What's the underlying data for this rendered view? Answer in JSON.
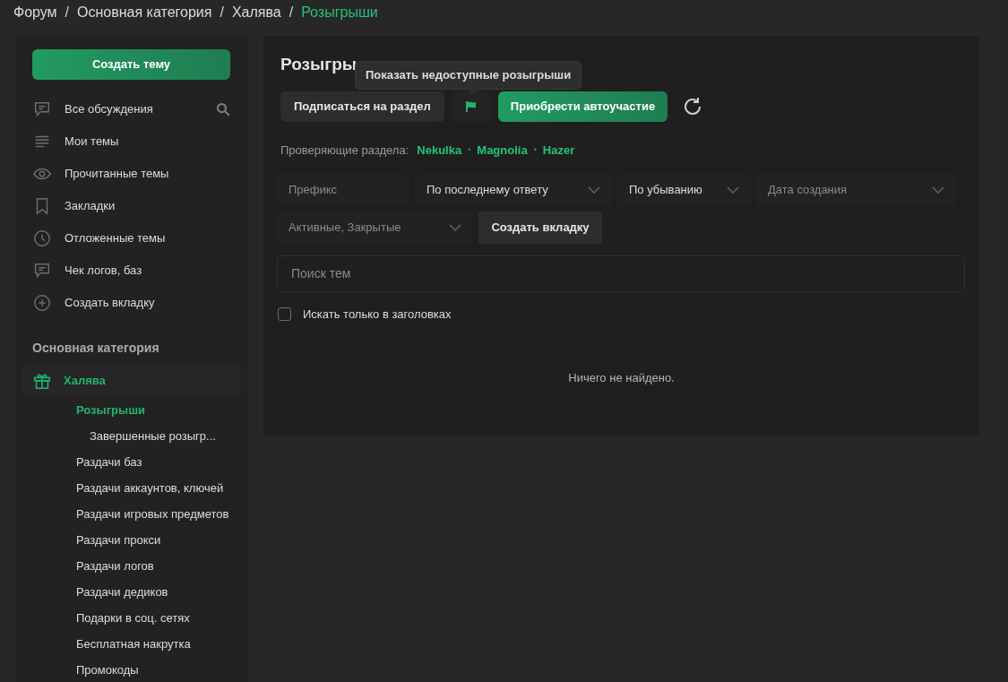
{
  "breadcrumbs": [
    {
      "label": "Форум",
      "selected": false
    },
    {
      "label": "Основная категория",
      "selected": false
    },
    {
      "label": "Халява",
      "selected": false
    },
    {
      "label": "Розыгрыши",
      "selected": true
    }
  ],
  "breadcrumb_separator": "/",
  "sidebar": {
    "create_button": "Создать тему",
    "nav_items": [
      {
        "label": "Все обсуждения",
        "search": true
      },
      {
        "label": "Мои темы",
        "search": false
      },
      {
        "label": "Прочитанные темы",
        "search": false
      },
      {
        "label": "Закладки",
        "search": false
      },
      {
        "label": "Отложенные темы",
        "search": false
      },
      {
        "label": "Чек логов, баз",
        "search": false
      },
      {
        "label": "Создать вкладку",
        "search": false
      }
    ],
    "section_title": "Основная категория",
    "categories": [
      {
        "label": "Халява",
        "selected": true,
        "children": [
          {
            "label": "Розыгрыши",
            "selected": true,
            "children": [
              {
                "label": "Завершенные розыгр...",
                "selected": false
              }
            ]
          },
          {
            "label": "Раздачи баз",
            "selected": false
          },
          {
            "label": "Раздачи аккаунтов, ключей",
            "selected": false
          },
          {
            "label": "Раздачи игровых предметов",
            "selected": false
          },
          {
            "label": "Раздачи прокси",
            "selected": false
          },
          {
            "label": "Раздачи логов",
            "selected": false
          },
          {
            "label": "Раздачи дедиков",
            "selected": false
          },
          {
            "label": "Подарки в соц. сетях",
            "selected": false
          },
          {
            "label": "Бесплатная накрутка",
            "selected": false
          },
          {
            "label": "Промокоды",
            "selected": false
          }
        ]
      }
    ]
  },
  "main": {
    "title": "Розыгры",
    "tooltip": "Показать недоступные розыгрыши",
    "subscribe_button": "Подписаться на раздел",
    "autoparticipation_button": "Приобрести автоучастие",
    "moderators_label": "Проверяющие раздела:",
    "moderators": [
      "Nekulka",
      "Magnolia",
      "Hazer"
    ],
    "moderator_separator": "•",
    "filters": [
      [
        {
          "kind": "field",
          "placeholder": "Префикс"
        },
        {
          "kind": "select",
          "value": "По последнему ответу"
        },
        {
          "kind": "select",
          "value": "По убыванию"
        },
        {
          "kind": "select",
          "placeholder": "Дата создания"
        }
      ],
      [
        {
          "kind": "select",
          "placeholder": "Активные, Закрытые"
        },
        {
          "kind": "button",
          "label": "Создать вкладку"
        }
      ]
    ],
    "search": {
      "placeholder": "Поиск тем"
    },
    "titles_only": {
      "label": "Искать только в заголовках",
      "checked": false
    },
    "empty_message": "Ничего не найдено."
  }
}
